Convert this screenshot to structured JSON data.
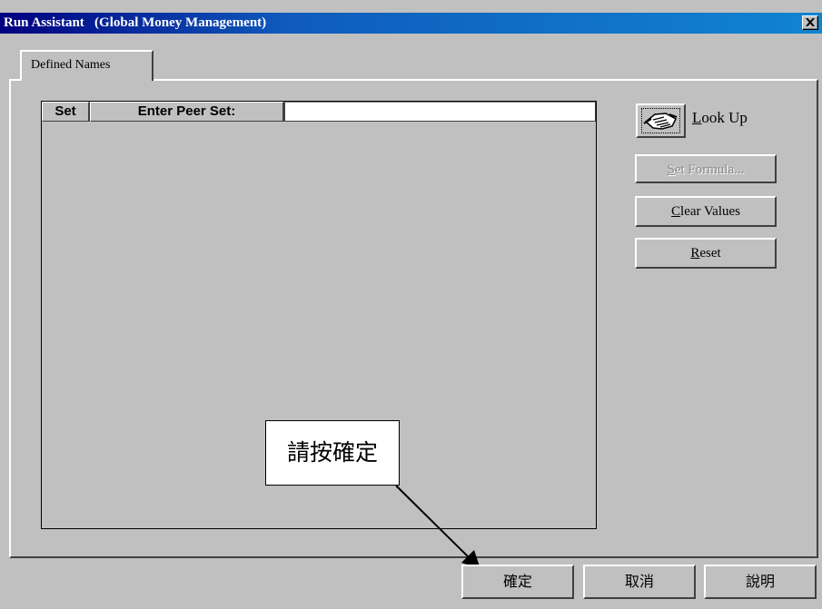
{
  "window": {
    "title": "Run Assistant   (Global Money Management)",
    "close_icon": "close-icon"
  },
  "tabs": [
    {
      "label": "Defined Names"
    }
  ],
  "grid": {
    "headers": [
      "Set",
      "Enter Peer Set:"
    ],
    "peer_set_value": ""
  },
  "side_buttons": {
    "look_up": {
      "label_first": "L",
      "label_rest": "ook Up",
      "icon": "handshake-icon"
    },
    "set_formula": {
      "label_first": "S",
      "label_rest": "et Formula..."
    },
    "clear_values": {
      "label_first": "C",
      "label_rest": "lear Values"
    },
    "reset": {
      "label_first": "R",
      "label_rest": "eset"
    }
  },
  "callout": {
    "text": "請按確定"
  },
  "footer": {
    "ok": "確定",
    "cancel": "取消",
    "help": "說明"
  }
}
